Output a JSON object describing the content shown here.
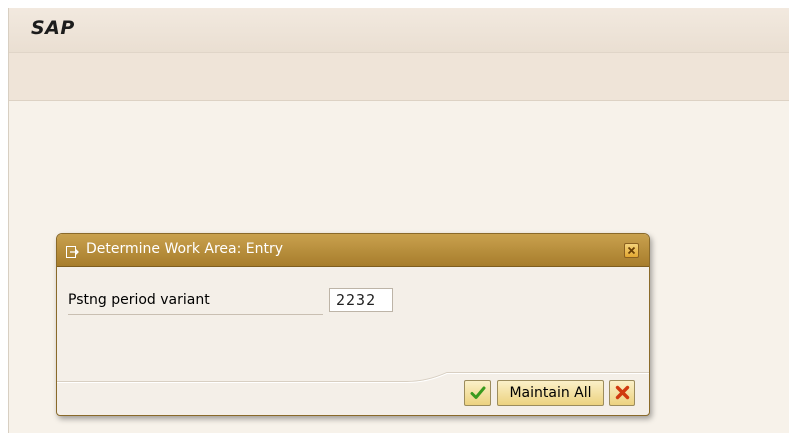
{
  "app": {
    "title": "SAP"
  },
  "dialog": {
    "title": "Determine Work Area: Entry",
    "field_label": "Pstng period variant",
    "field_value": "2232",
    "buttons": {
      "maintain_all_label": "Maintain All"
    }
  },
  "icons": {
    "dialog_icon": "entry-window-icon",
    "close": "close-icon",
    "continue": "checkmark-icon",
    "cancel": "cancel-x-icon"
  },
  "colors": {
    "dialog_header": "#b88d3a",
    "background": "#f7f2ea",
    "ok_green": "#3a9a1e",
    "cancel_red": "#d03a10"
  }
}
